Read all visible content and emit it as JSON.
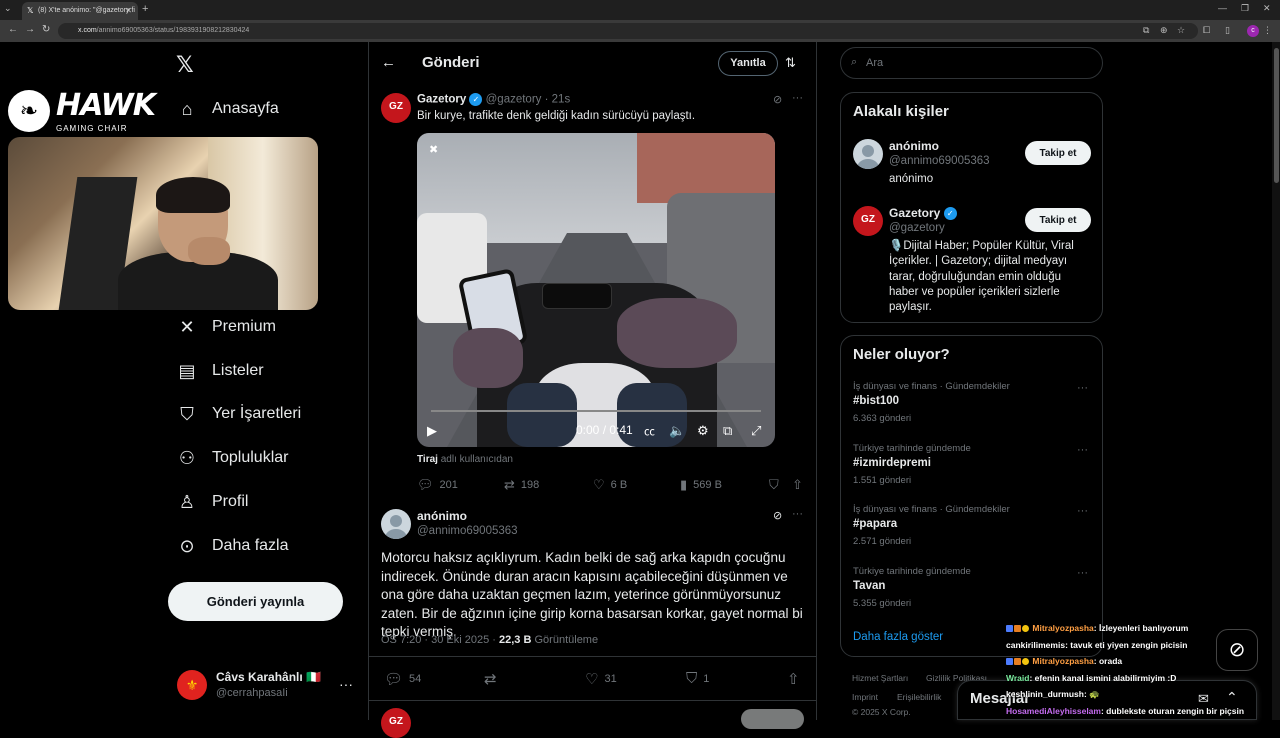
{
  "browser": {
    "tab_title": "(8) X'te anónimo: \"@gazetory fi",
    "url_host": "x.com",
    "url_path": "/annimo69005363/status/1983931908212830424"
  },
  "overlay": {
    "brand_title": "HAWK",
    "brand_sub": "GAMING CHAIR"
  },
  "nav": {
    "items": [
      {
        "label": "Anasayfa",
        "icon": "home-icon"
      },
      {
        "label": "Premium",
        "icon": "x-logo-icon"
      },
      {
        "label": "Listeler",
        "icon": "list-icon"
      },
      {
        "label": "Yer İşaretleri",
        "icon": "bookmark-icon"
      },
      {
        "label": "Topluluklar",
        "icon": "communities-icon"
      },
      {
        "label": "Profil",
        "icon": "profile-icon"
      },
      {
        "label": "Daha fazla",
        "icon": "more-icon"
      }
    ],
    "post_button": "Gönderi yayınla",
    "user": {
      "name": "Câvs Karahânlı 🇮🇹",
      "handle": "@cerrahpasaIi"
    }
  },
  "header": {
    "title": "Gönderi",
    "reply_button": "Yanıtla"
  },
  "quoted_post": {
    "author": "Gazetory",
    "handle": "@gazetory",
    "time": "· 21s",
    "text": "Bir kurye, trafikte denk geldiği kadın sürücüyü paylaştı.",
    "video_time": "0:00 / 0:41",
    "credit_name": "Tiraj",
    "credit_rest": "adlı kullanıcıdan",
    "stats": {
      "replies": "201",
      "reposts": "198",
      "likes": "6 B",
      "views": "569 B"
    }
  },
  "main_post": {
    "author": "anónimo",
    "handle": "@annimo69005363",
    "text": "Motorcu haksız açıklıyrum. Kadın belki de sağ arka kapıdn çocuğnu indirecek. Önünde duran aracın kapısını açabileceğini düşünmen ve ona göre daha uzaktan geçmen lazım, yeterince görünmüyorsunuz zaten. Bir de ağzının içine girip korna basarsan korkar, gayet normal bi tepki vermiş.",
    "timestamp": "ÖS 7:20 · 30 Eki 2025 ·",
    "views_count": "22,3 B",
    "views_label": "Görüntüleme",
    "stats": {
      "replies": "54",
      "likes": "31",
      "bookmarks": "1"
    }
  },
  "search": {
    "placeholder": "Ara"
  },
  "related": {
    "title": "Alakalı kişiler",
    "people": [
      {
        "name": "anónimo",
        "handle": "@annimo69005363",
        "bio": "anónimo",
        "button": "Takip et"
      },
      {
        "name": "Gazetory",
        "handle": "@gazetory",
        "bio": "🎙️Dijital Haber; Popüler Kültür, Viral İçerikler. | Gazetory; dijital medyayı tarar, doğruluğundan emin olduğu haber ve popüler içerikleri sizlerle paylaşır.",
        "button": "Takip et"
      }
    ]
  },
  "trends": {
    "title": "Neler oluyor?",
    "items": [
      {
        "context": "İş dünyası ve finans · Gündemdekiler",
        "name": "#bist100",
        "count": "6.363 gönderi"
      },
      {
        "context": "Türkiye tarihinde gündemde",
        "name": "#izmirdepremi",
        "count": "1.551 gönderi"
      },
      {
        "context": "İş dünyası ve finans · Gündemdekiler",
        "name": "#papara",
        "count": "2.571 gönderi"
      },
      {
        "context": "Türkiye tarihinde gündemde",
        "name": "Tavan",
        "count": "5.355 gönderi"
      }
    ],
    "show_more": "Daha fazla göster"
  },
  "footer": {
    "links": [
      "Hizmet Şartları",
      "Gizlilik Politikası",
      "Imprint",
      "Erişilebilirlik"
    ],
    "copyright": "© 2025 X Corp."
  },
  "messages": {
    "label": "Mesajlar"
  },
  "chat": [
    {
      "user": "Mitralyozpasha",
      "color": "#ff9f43",
      "text": ": İzleyenleri banlıyorum"
    },
    {
      "user": "cankirilimemis",
      "color": "#ffffff",
      "text": ": tavuk eti yiyen zengin picisin"
    },
    {
      "user": "Mitralyozpasha",
      "color": "#ff9f43",
      "text": ": orada"
    },
    {
      "user": "Wraid",
      "color": "#7bed9f",
      "text": ": efenin kanal ismini alabilirmiyim :D"
    },
    {
      "user": "keshlinin_durmush",
      "color": "#ffffff",
      "text": ": 🐢"
    },
    {
      "user": "HosamediAleyhisselam",
      "color": "#c56cf0",
      "text": ": dublekste oturan zengin bir piçsin"
    }
  ]
}
